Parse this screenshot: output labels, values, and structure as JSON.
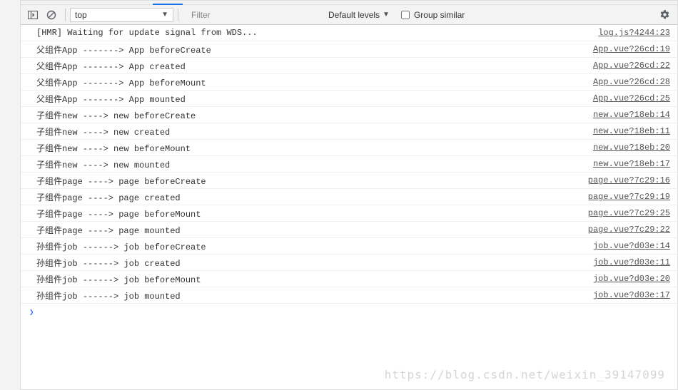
{
  "toolbar": {
    "context": "top",
    "filter_placeholder": "Filter",
    "levels_label": "Default levels",
    "group_similar_label": "Group similar"
  },
  "logs": [
    {
      "msg": "[HMR] Waiting for update signal from WDS...",
      "src": "log.js?4244:23"
    },
    {
      "msg": "父组件App -------> App beforeCreate",
      "src": "App.vue?26cd:19"
    },
    {
      "msg": "父组件App -------> App created",
      "src": "App.vue?26cd:22"
    },
    {
      "msg": "父组件App -------> App beforeMount",
      "src": "App.vue?26cd:28"
    },
    {
      "msg": "父组件App -------> App mounted",
      "src": "App.vue?26cd:25"
    },
    {
      "msg": "子组件new ----> new beforeCreate",
      "src": "new.vue?18eb:14"
    },
    {
      "msg": "子组件new ----> new created",
      "src": "new.vue?18eb:11"
    },
    {
      "msg": "子组件new ----> new beforeMount",
      "src": "new.vue?18eb:20"
    },
    {
      "msg": "子组件new ----> new mounted",
      "src": "new.vue?18eb:17"
    },
    {
      "msg": "子组件page ----> page beforeCreate",
      "src": "page.vue?7c29:16"
    },
    {
      "msg": "子组件page ----> page created",
      "src": "page.vue?7c29:19"
    },
    {
      "msg": "子组件page ----> page beforeMount",
      "src": "page.vue?7c29:25"
    },
    {
      "msg": "子组件page ----> page mounted",
      "src": "page.vue?7c29:22"
    },
    {
      "msg": "孙组件job ------> job beforeCreate",
      "src": "job.vue?d03e:14"
    },
    {
      "msg": "孙组件job ------> job created",
      "src": "job.vue?d03e:11"
    },
    {
      "msg": "孙组件job ------> job beforeMount",
      "src": "job.vue?d03e:20"
    },
    {
      "msg": "孙组件job ------> job mounted",
      "src": "job.vue?d03e:17"
    }
  ],
  "watermark": "https://blog.csdn.net/weixin_39147099"
}
